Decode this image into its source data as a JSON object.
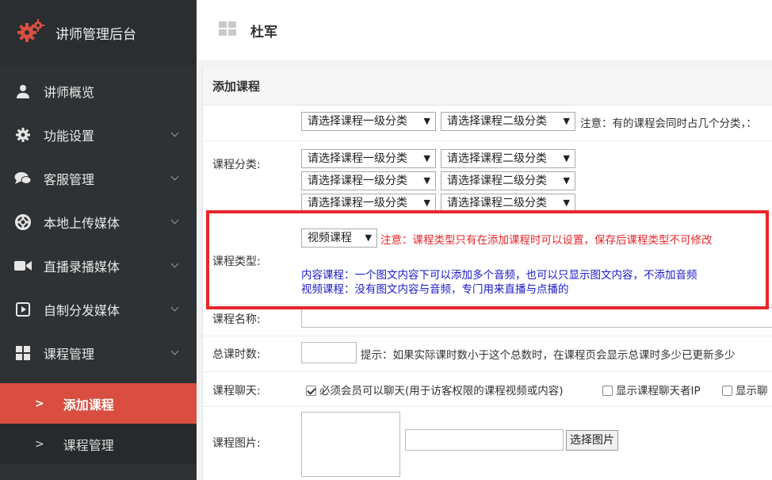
{
  "sidebar": {
    "brand": "讲师管理后台",
    "items": [
      {
        "label": "讲师概览",
        "icon": "user-icon",
        "chevron": false
      },
      {
        "label": "功能设置",
        "icon": "gear-icon",
        "chevron": true
      },
      {
        "label": "客服管理",
        "icon": "chat-icon",
        "chevron": true
      },
      {
        "label": "本地上传媒体",
        "icon": "lifebuoy-icon",
        "chevron": true
      },
      {
        "label": "直播录播媒体",
        "icon": "video-camera-icon",
        "chevron": true
      },
      {
        "label": "自制分发媒体",
        "icon": "play-square-icon",
        "chevron": true
      },
      {
        "label": "课程管理",
        "icon": "grid-icon",
        "chevron": true
      }
    ],
    "sub_items": [
      {
        "label": "添加课程",
        "active": true
      },
      {
        "label": "课程管理",
        "active": false
      }
    ]
  },
  "header": {
    "username": "杜军"
  },
  "form": {
    "section_title": "添加课程",
    "category": {
      "label": "课程分类:",
      "level1_placeholder": "请选择课程一级分类",
      "level2_placeholder": "请选择课程二级分类",
      "note": "注意：有的课程会同时占几个分类，："
    },
    "type": {
      "label": "课程类型:",
      "selected": "视频课程",
      "warning": "注意：课程类型只有在添加课程时可以设置，保存后课程类型不可修改",
      "desc_content": "内容课程：一个图文内容下可以添加多个音频，也可以只显示图文内容，不添加音频",
      "desc_video": "视频课程：没有图文内容与音频，专门用来直播与点播的"
    },
    "name": {
      "label": "课程名称:",
      "value": ""
    },
    "hours": {
      "label": "总课时数:",
      "value": "",
      "hint": "提示：如果实际课时数小于这个总数时，在课程页会显示总课时多少已更新多少"
    },
    "chat": {
      "label": "课程聊天:",
      "options": [
        {
          "label": "必须会员可以聊天(用于访客权限的课程视频或内容)",
          "checked": true
        },
        {
          "label": "显示课程聊天者IP",
          "checked": false
        },
        {
          "label": "显示聊",
          "checked": false
        }
      ]
    },
    "image": {
      "label": "课程图片:",
      "path": "",
      "button": "选择图片"
    }
  },
  "colors": {
    "sidebar_bg": "#2f3234",
    "active_bg": "#d94e40",
    "warning_red": "#e8272b",
    "desc_blue": "#1a1acb"
  }
}
